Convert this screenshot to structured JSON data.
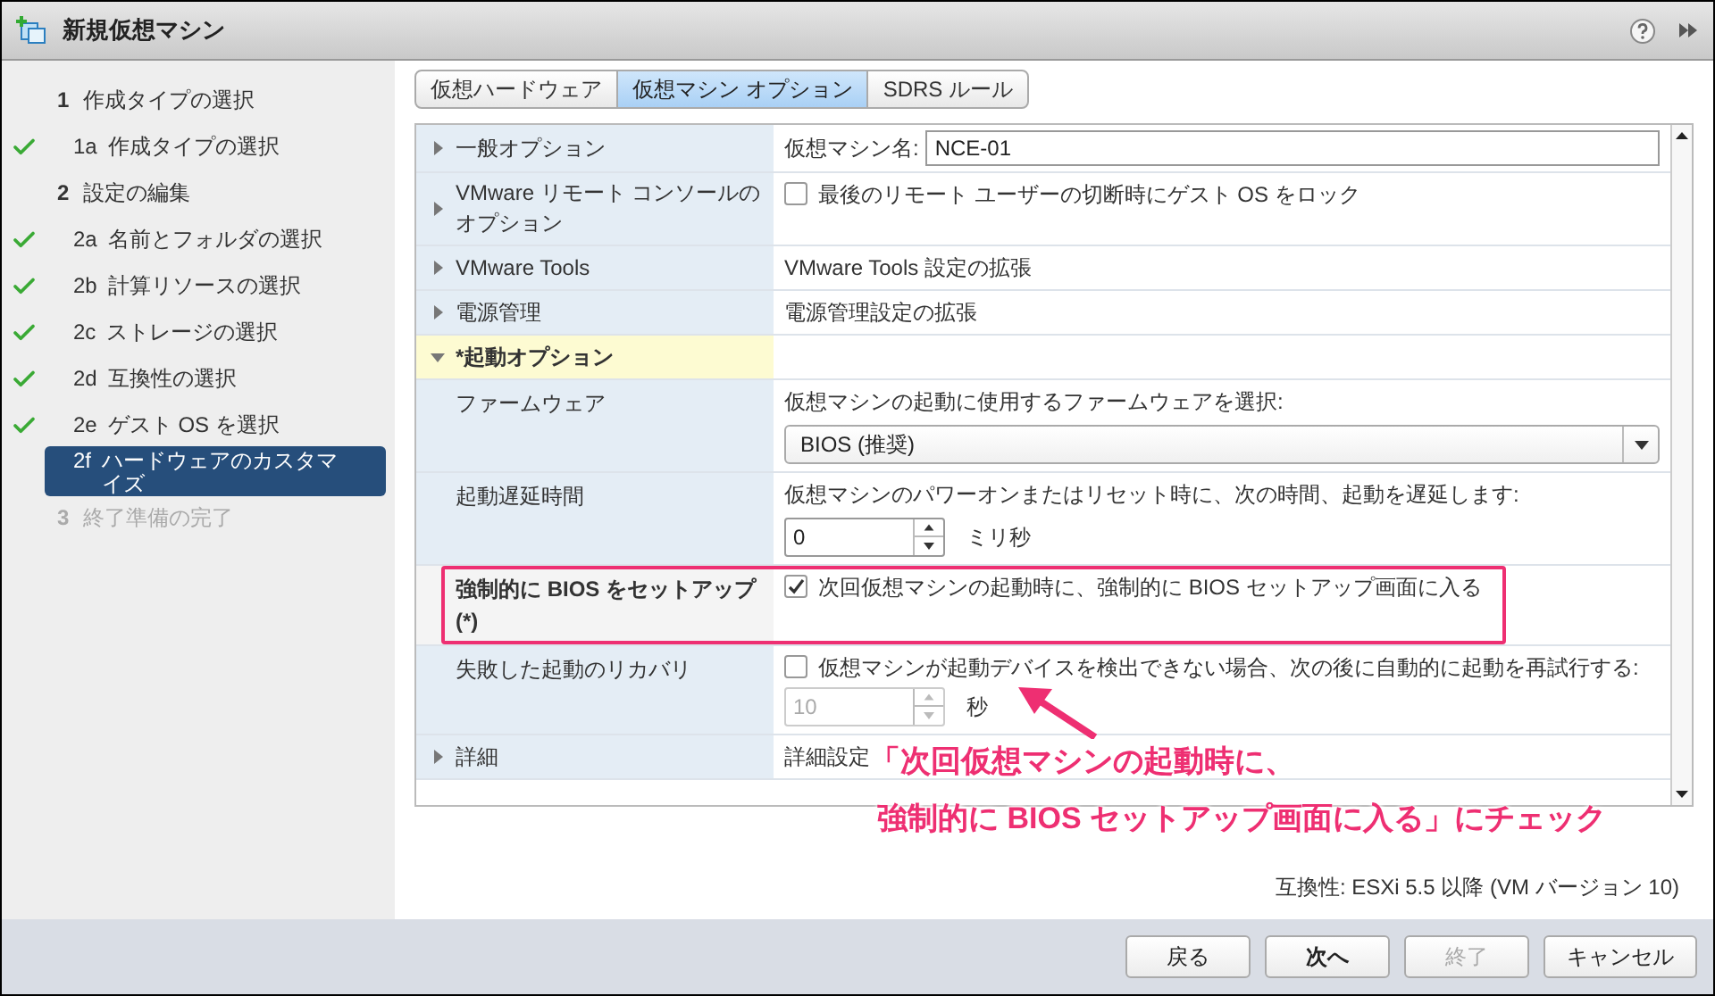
{
  "window": {
    "title": "新規仮想マシン"
  },
  "steps": [
    {
      "number": "1",
      "label": "作成タイプの選択",
      "disabled": false,
      "children": [
        {
          "number": "1a",
          "label": "作成タイプの選択",
          "done": true,
          "selected": false
        }
      ]
    },
    {
      "number": "2",
      "label": "設定の編集",
      "disabled": false,
      "children": [
        {
          "number": "2a",
          "label": "名前とフォルダの選択",
          "done": true,
          "selected": false
        },
        {
          "number": "2b",
          "label": "計算リソースの選択",
          "done": true,
          "selected": false
        },
        {
          "number": "2c",
          "label": "ストレージの選択",
          "done": true,
          "selected": false
        },
        {
          "number": "2d",
          "label": "互換性の選択",
          "done": true,
          "selected": false
        },
        {
          "number": "2e",
          "label": "ゲスト OS を選択",
          "done": true,
          "selected": false
        },
        {
          "number": "2f",
          "label": "ハードウェアのカスタマイズ",
          "done": false,
          "selected": true
        }
      ]
    },
    {
      "number": "3",
      "label": "終了準備の完了",
      "disabled": true
    }
  ],
  "tabs": [
    {
      "label": "仮想ハードウェア",
      "selected": false
    },
    {
      "label": "仮想マシン オプション",
      "selected": true
    },
    {
      "label": "SDRS ルール",
      "selected": false
    }
  ],
  "sections": [
    {
      "label": "一般オプション",
      "expanded": false,
      "value": {
        "kind": "field",
        "label": "仮想マシン名:",
        "value": "NCE-01"
      }
    },
    {
      "label": "VMware リモート コンソールのオプション",
      "expanded": false,
      "value": {
        "kind": "checkbox",
        "checked": false,
        "label": "最後のリモート ユーザーの切断時にゲスト OS をロック"
      }
    },
    {
      "label": "VMware Tools",
      "expanded": false,
      "value": {
        "kind": "text",
        "text": "VMware Tools 設定の拡張"
      }
    },
    {
      "label": "電源管理",
      "expanded": false,
      "value": {
        "kind": "text",
        "text": "電源管理設定の拡張"
      }
    },
    {
      "label": "*起動オプション",
      "expanded": true,
      "value": {
        "kind": "none"
      },
      "children": [
        {
          "label": "ファームウェア",
          "changed": false,
          "annotated": false,
          "value": {
            "kind": "select",
            "text": "仮想マシンの起動に使用するファームウェアを選択:",
            "value": "BIOS (推奨)"
          }
        },
        {
          "label": "起動遅延時間",
          "changed": false,
          "annotated": false,
          "value": {
            "kind": "spinner",
            "text": "仮想マシンのパワーオンまたはリセット時に、次の時間、起動を遅延します:",
            "value": "0",
            "unit": "ミリ秒",
            "disabled": false
          }
        },
        {
          "label": "強制的に BIOS をセットアップ (*)",
          "changed": true,
          "annotated": true,
          "value": {
            "kind": "checkbox",
            "checked": true,
            "label": "次回仮想マシンの起動時に、強制的に BIOS セットアップ画面に入る"
          }
        },
        {
          "label": "失敗した起動のリカバリ",
          "changed": false,
          "annotated": false,
          "value": {
            "kind": "checkbox_spinner",
            "checked": false,
            "label": "仮想マシンが起動デバイスを検出できない場合、次の後に自動的に起動を再試行する:",
            "value": "10",
            "unit": "秒",
            "disabled": true
          }
        }
      ]
    },
    {
      "label": "詳細",
      "expanded": false,
      "value": {
        "kind": "text",
        "text": "詳細設定"
      }
    }
  ],
  "compatibility": "互換性: ESXi 5.5 以降 (VM バージョン 10)",
  "callout": {
    "lines": [
      "「次回仮想マシンの起動時に、",
      "強制的に BIOS セットアップ画面に入る」にチェック"
    ]
  },
  "buttons": [
    {
      "label": "戻る",
      "disabled": false,
      "default": false
    },
    {
      "label": "次へ",
      "disabled": false,
      "default": true
    },
    {
      "label": "終了",
      "disabled": true,
      "default": false
    },
    {
      "label": "キャンセル",
      "disabled": false,
      "default": false
    }
  ]
}
